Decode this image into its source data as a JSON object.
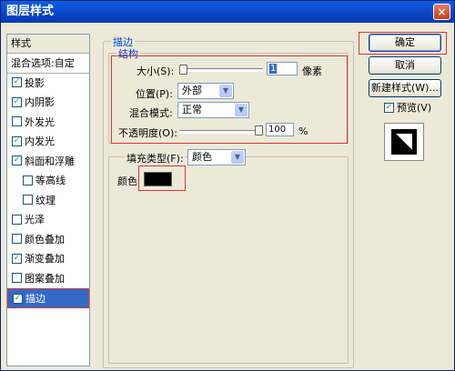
{
  "window": {
    "title": "图层样式",
    "close_glyph": "×"
  },
  "left_panel": {
    "header": "样式",
    "blend_options": "混合选项:自定",
    "items": [
      {
        "label": "投影",
        "checked": true,
        "indent": false,
        "selected": false
      },
      {
        "label": "内阴影",
        "checked": true,
        "indent": false,
        "selected": false
      },
      {
        "label": "外发光",
        "checked": false,
        "indent": false,
        "selected": false
      },
      {
        "label": "内发光",
        "checked": true,
        "indent": false,
        "selected": false
      },
      {
        "label": "斜面和浮雕",
        "checked": true,
        "indent": false,
        "selected": false
      },
      {
        "label": "等高线",
        "checked": false,
        "indent": true,
        "selected": false
      },
      {
        "label": "纹理",
        "checked": false,
        "indent": true,
        "selected": false
      },
      {
        "label": "光泽",
        "checked": false,
        "indent": false,
        "selected": false
      },
      {
        "label": "颜色叠加",
        "checked": false,
        "indent": false,
        "selected": false
      },
      {
        "label": "渐变叠加",
        "checked": true,
        "indent": false,
        "selected": false
      },
      {
        "label": "图案叠加",
        "checked": false,
        "indent": false,
        "selected": false
      },
      {
        "label": "描边",
        "checked": true,
        "indent": false,
        "selected": true
      }
    ]
  },
  "stroke": {
    "group_label": "描边",
    "structure_label": "结构",
    "size_label": "大小(S):",
    "size_value": "1",
    "size_unit": "像素",
    "position_label": "位置(P):",
    "position_value": "外部",
    "blend_label": "混合模式:",
    "blend_value": "正常",
    "opacity_label": "不透明度(O):",
    "opacity_value": "100",
    "opacity_unit": "%",
    "opacity_level": 1.0,
    "size_level": 0.0,
    "fill_type_label": "填充类型(F):",
    "fill_type_value": "颜色",
    "color_label": "颜色",
    "color_value": "#000000"
  },
  "buttons": {
    "ok": "确定",
    "cancel": "取消",
    "new_style": "新建样式(W)...",
    "preview": "预览(V)",
    "preview_checked": true
  },
  "colors": {
    "accent": "#316ac5",
    "highlight_border": "#dd3333",
    "group_label": "#0046d5"
  }
}
